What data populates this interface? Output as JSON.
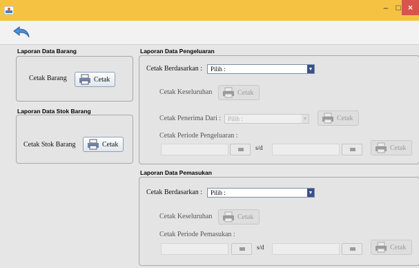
{
  "window": {
    "minimize": "–",
    "maximize": "□",
    "close": "×"
  },
  "barang": {
    "title": "Laporan Data Barang",
    "label": "Cetak Barang",
    "button": "Cetak"
  },
  "stok": {
    "title": "Laporan Data Stok Barang",
    "label": "Cetak Stok Barang",
    "button": "Cetak"
  },
  "pengeluaran": {
    "title": "Laporan Data Pengeluaran",
    "berdasarkan_label": "Cetak Berdasarkan :",
    "berdasarkan_value": "Pilih :",
    "keseluruhan_label": "Cetak Keseluruhan",
    "keseluruhan_button": "Cetak",
    "penerima_label": "Cetak Penerima Dari :",
    "penerima_value": "Pilih :",
    "penerima_button": "Cetak",
    "periode_label": "Cetak Periode Pengeluaran :",
    "sd": "s/d",
    "periode_button": "Cetak"
  },
  "pemasukan": {
    "title": "Laporan Data Pemasukan",
    "berdasarkan_label": "Cetak Berdasarkan :",
    "berdasarkan_value": "Pilih :",
    "keseluruhan_label": "Cetak Keseluruhan",
    "keseluruhan_button": "Cetak",
    "periode_label": "Cetak Periode Pemasukan :",
    "sd": "s/d",
    "periode_button": "Cetak"
  }
}
